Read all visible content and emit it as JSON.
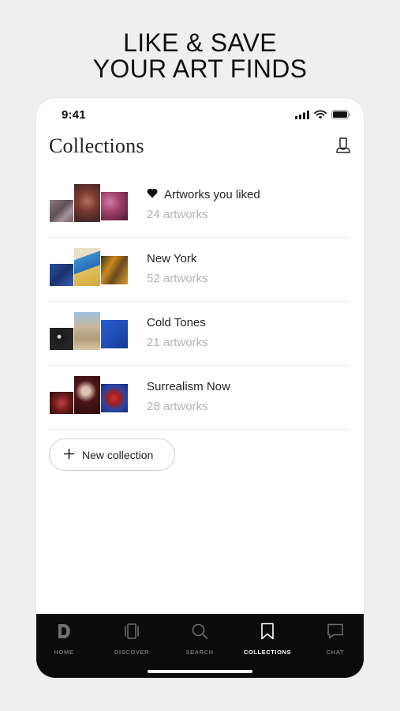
{
  "headline": {
    "line1": "LIKE & SAVE",
    "line2": "YOUR ART FINDS"
  },
  "status_bar": {
    "time": "9:41"
  },
  "page": {
    "title": "Collections"
  },
  "collections": [
    {
      "title": "Artworks you liked",
      "count": "24 artworks",
      "icon": "heart-icon",
      "thumb_colors": [
        "#7a6a6e",
        "#8b4a3e",
        "#a0426c"
      ]
    },
    {
      "title": "New York",
      "count": "52 artworks",
      "icon": null,
      "thumb_colors": [
        "#1f3e86",
        "#3a8fd0",
        "#c98a1f"
      ]
    },
    {
      "title": "Cold Tones",
      "count": "21 artworks",
      "icon": null,
      "thumb_colors": [
        "#1b1b1b",
        "#c8b79a",
        "#1f4fb8"
      ]
    },
    {
      "title": "Surrealism Now",
      "count": "28 artworks",
      "icon": null,
      "thumb_colors": [
        "#6d1c1c",
        "#4a1618",
        "#2a45a8"
      ]
    }
  ],
  "new_collection": {
    "label": "New collection"
  },
  "tab_bar": {
    "tabs": [
      {
        "label": "HOME",
        "icon": "home-logo-icon",
        "active": false
      },
      {
        "label": "DISCOVER",
        "icon": "cards-icon",
        "active": false
      },
      {
        "label": "SEARCH",
        "icon": "search-icon",
        "active": false
      },
      {
        "label": "COLLECTIONS",
        "icon": "bookmark-icon",
        "active": true
      },
      {
        "label": "CHAT",
        "icon": "chat-icon",
        "active": false
      }
    ]
  }
}
